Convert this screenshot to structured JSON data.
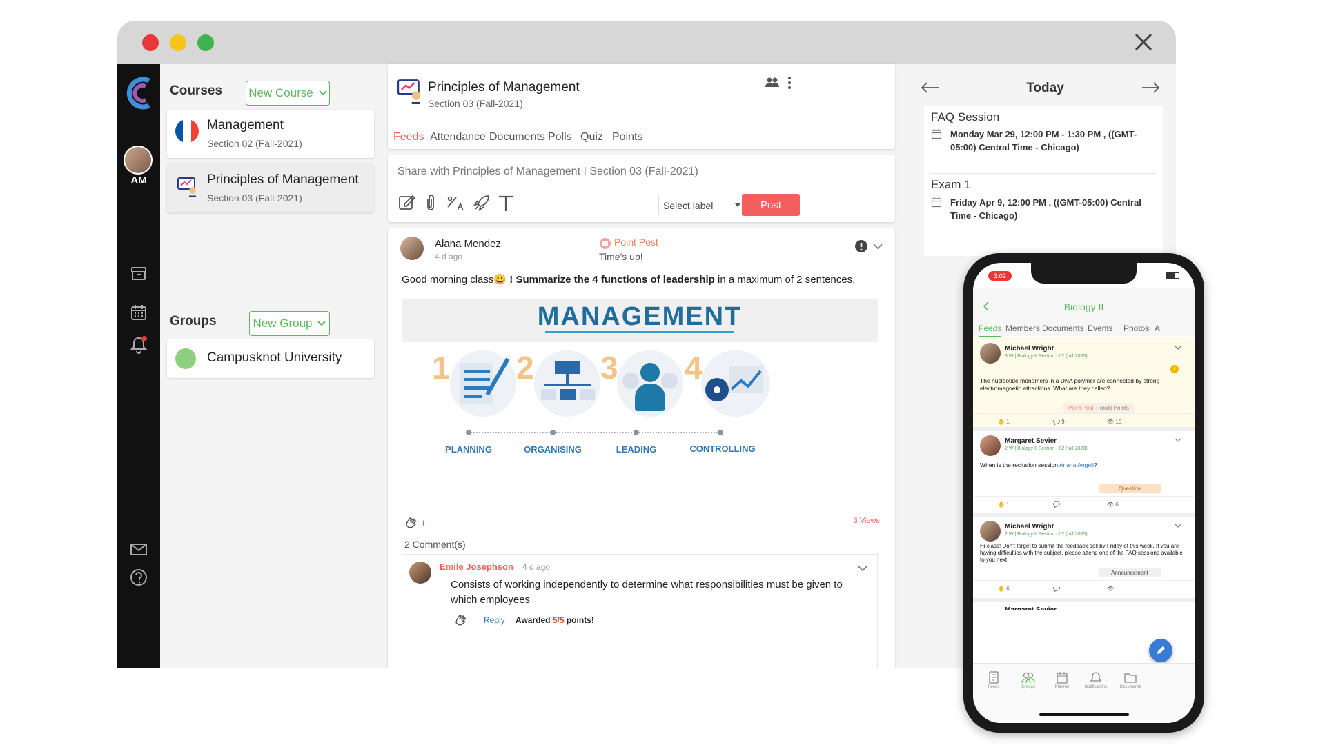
{
  "colors": {
    "accent": "#5cb85c",
    "post": "#f25f5c",
    "danger": "#e53935",
    "dot_red": "#e5383b",
    "dot_yellow": "#f5c518",
    "dot_green": "#3fb34f"
  },
  "rail": {
    "user_initials": "AM"
  },
  "courses": {
    "heading": "Courses",
    "new_button": "New Course",
    "items": [
      {
        "name": "Management",
        "section": "Section 02 (Fall-2021)"
      },
      {
        "name": "Principles of Management",
        "section": "Section 03 (Fall-2021)"
      }
    ]
  },
  "groups": {
    "heading": "Groups",
    "new_button": "New Group",
    "items": [
      {
        "name": "Campusknot University"
      }
    ]
  },
  "course_header": {
    "title": "Principles of Management",
    "section": "Section 03 (Fall-2021)",
    "tabs": [
      "Feeds",
      "Attendance",
      "Documents",
      "Polls",
      "Quiz",
      "Points"
    ]
  },
  "composer": {
    "placeholder": "Share with Principles of Management I Section 03 (Fall-2021)",
    "select_label": "Select label",
    "post_button": "Post"
  },
  "post": {
    "author": "Alana Mendez",
    "time": "4 d ago",
    "type": "Point Post",
    "subtitle": "Time's up!",
    "text_before": "Good morning class",
    "emoji": "😀",
    "text_mid": " ! ",
    "text_bold": "Summarize the 4 functions of leadership",
    "text_after": " in a maximum of 2 sentences.",
    "image_title": "MANAGEMENT",
    "image_steps": [
      {
        "num": "1",
        "label": "PLANNING"
      },
      {
        "num": "2",
        "label": "ORGANISING"
      },
      {
        "num": "3",
        "label": "LEADING"
      },
      {
        "num": "4",
        "label": "CONTROLLING"
      }
    ],
    "claps": "1",
    "views": "3 Views",
    "comments_count": "2 Comment(s)",
    "comment": {
      "author": "Emile Josephson",
      "time": "4 d ago",
      "text": "Consists of working independently to determine what responsibilities must be given to which employees",
      "reply": "Reply",
      "awarded_prefix": "Awarded",
      "awarded_score": "5/5",
      "awarded_suffix": "points!"
    }
  },
  "calendar": {
    "title": "Today",
    "events": [
      {
        "title": "FAQ Session",
        "time": "Monday Mar 29, 12:00 PM - 1:30 PM , ((GMT-05:00) Central Time - Chicago)"
      },
      {
        "title": "Exam 1",
        "time": "Friday Apr 9, 12:00 PM , ((GMT-05:00) Central Time - Chicago)"
      }
    ]
  },
  "phone": {
    "clock": "3:02",
    "group": "Biology II",
    "tabs": [
      "Feeds",
      "Members",
      "Documents",
      "Events",
      "Photos",
      "A"
    ],
    "posts": [
      {
        "author": "Michael Wright",
        "meta": "3 W | Biology II Section - 02 (fall-2020)",
        "text": "The nucleotide monomers in a DNA polymer are connected by strong electromagnetic attractions. What are they called?",
        "tag": "Point Post",
        "tag2": "+ (null) Points",
        "claps": "1",
        "comments": "9",
        "views": "15"
      },
      {
        "author": "Margaret Sevier",
        "meta": "2 W | Biology II Section - 02 (fall-2020)",
        "text": "When is the recitation session ",
        "mention": "Ariana Angeli",
        "text_end": "?",
        "tag": "Question",
        "claps": "1",
        "views": "6"
      },
      {
        "author": "Michael Wright",
        "meta": "2 W | Biology II Section - 02 (fall-2020)",
        "text": "Hi class! Don't forget to submit the feedback poll by Friday of this week. If you are having difficulties with the subject, please attend one of the FAQ sessions available to you next",
        "tag": "Announcement",
        "claps": "6"
      },
      {
        "author": "Margaret Sevier"
      }
    ],
    "nav": [
      "Feeds",
      "Groups",
      "Planner",
      "Notifications",
      "Documents"
    ]
  }
}
